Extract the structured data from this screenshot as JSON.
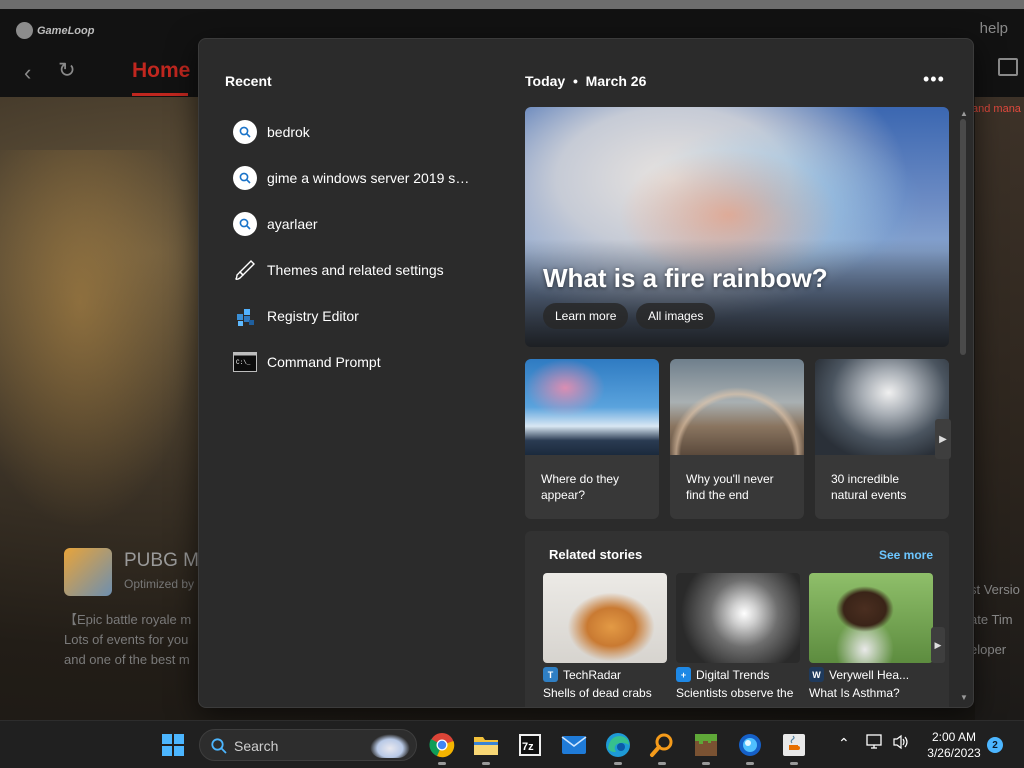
{
  "background_app": {
    "logo": "GameLoop",
    "help": "help",
    "nav_home": "Home",
    "tag_right": "and mana",
    "game_title": "PUBG M",
    "game_subtitle": "Optimized by",
    "game_desc": [
      "【Epic battle royale m",
      "Lots of events for you",
      "and one of the best m"
    ],
    "right_texts": [
      "st Versio",
      "ate  Tim",
      "eloper"
    ]
  },
  "flyout": {
    "recent_title": "Recent",
    "recent": [
      {
        "label": "bedrok",
        "icon": "search-icon"
      },
      {
        "label": "gime a windows server 2019 ses...",
        "icon": "search-icon"
      },
      {
        "label": "ayarlaer",
        "icon": "search-icon"
      },
      {
        "label": "Themes and related settings",
        "icon": "brush-icon"
      },
      {
        "label": "Registry Editor",
        "icon": "registry-editor-icon"
      },
      {
        "label": "Command Prompt",
        "icon": "command-prompt-icon"
      }
    ],
    "today_label": "Today",
    "date": "March 26",
    "more": "•••",
    "hero": {
      "title": "What is a fire rainbow?",
      "learn_more": "Learn more",
      "all_images": "All images"
    },
    "cards": [
      {
        "line1": "Where do they",
        "line2": "appear?"
      },
      {
        "line1": "Why you'll never",
        "line2": "find the end"
      },
      {
        "line1": "30 incredible",
        "line2": "natural events"
      }
    ],
    "related": {
      "title": "Related stories",
      "see_more": "See more",
      "stories": [
        {
          "source": "TechRadar",
          "headline": "Shells of dead crabs"
        },
        {
          "source": "Digital Trends",
          "headline": "Scientists observe the"
        },
        {
          "source": "Verywell Hea...",
          "headline": "What Is Asthma?"
        }
      ]
    }
  },
  "taskbar": {
    "search_placeholder": "Search",
    "apps": [
      "chrome-icon",
      "file-explorer-icon",
      "7zip-icon",
      "mail-icon",
      "edge-icon",
      "search-app-icon",
      "minecraft-icon",
      "app-orb-icon",
      "java-icon"
    ],
    "time": "2:00 AM",
    "date": "3/26/2023",
    "notification_count": "2"
  }
}
